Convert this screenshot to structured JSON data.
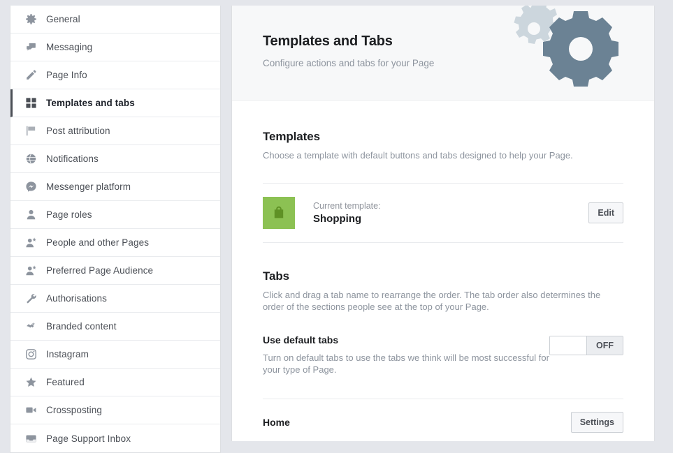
{
  "sidebar": {
    "items": [
      {
        "label": "General",
        "icon": "gear-icon",
        "selected": false
      },
      {
        "label": "Messaging",
        "icon": "chat-bubbles-icon",
        "selected": false
      },
      {
        "label": "Page Info",
        "icon": "pencil-icon",
        "selected": false
      },
      {
        "label": "Templates and tabs",
        "icon": "grid-squares-icon",
        "selected": true
      },
      {
        "label": "Post attribution",
        "icon": "flag-icon",
        "selected": false
      },
      {
        "label": "Notifications",
        "icon": "globe-icon",
        "selected": false
      },
      {
        "label": "Messenger platform",
        "icon": "messenger-icon",
        "selected": false
      },
      {
        "label": "Page roles",
        "icon": "person-icon",
        "selected": false
      },
      {
        "label": "People and other Pages",
        "icon": "person-star-icon",
        "selected": false
      },
      {
        "label": "Preferred Page Audience",
        "icon": "person-star-icon",
        "selected": false
      },
      {
        "label": "Authorisations",
        "icon": "wrench-icon",
        "selected": false
      },
      {
        "label": "Branded content",
        "icon": "handshake-icon",
        "selected": false
      },
      {
        "label": "Instagram",
        "icon": "instagram-icon",
        "selected": false
      },
      {
        "label": "Featured",
        "icon": "star-icon",
        "selected": false
      },
      {
        "label": "Crossposting",
        "icon": "video-camera-icon",
        "selected": false
      },
      {
        "label": "Page Support Inbox",
        "icon": "inbox-icon",
        "selected": false
      }
    ]
  },
  "header": {
    "title": "Templates and Tabs",
    "subtitle": "Configure actions and tabs for your Page",
    "graphic": "two-gears-icon",
    "gear_color_light": "#ccd6dd",
    "gear_color_dark": "#6b8294"
  },
  "templates": {
    "title": "Templates",
    "description": "Choose a template with default buttons and tabs designed to help your Page.",
    "current_template_caption": "Current template:",
    "current_template_name": "Shopping",
    "thumb_icon": "shopping-bag-icon",
    "thumb_bg_color": "#8cc153",
    "thumb_icon_color": "#5f9125",
    "edit_label": "Edit"
  },
  "tabs": {
    "title": "Tabs",
    "description": "Click and drag a tab name to rearrange the order. The tab order also determines the order of the sections people see at the top of your Page.",
    "default_tabs_title": "Use default tabs",
    "default_tabs_description": "Turn on default tabs to use the tabs we think will be most successful for your type of Page.",
    "toggle_state": "OFF",
    "rows": [
      {
        "label": "Home",
        "button_label": "Settings"
      }
    ]
  }
}
